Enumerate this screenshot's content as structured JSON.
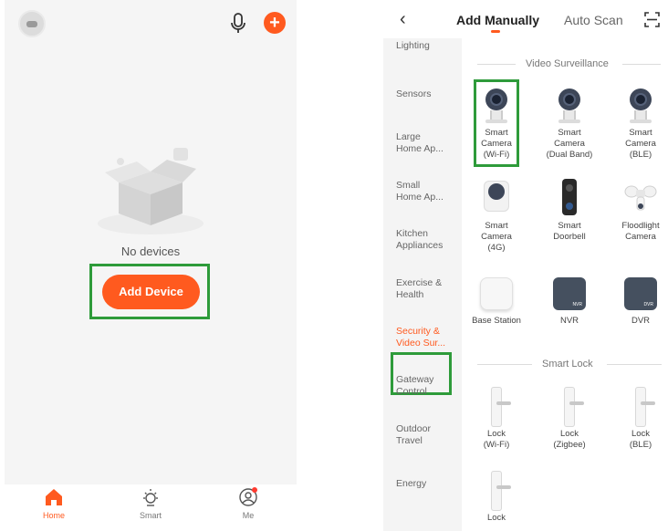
{
  "left_screen": {
    "empty_state_text": "No devices",
    "add_device_label": "Add Device",
    "tabs": [
      {
        "label": "Home",
        "active": true
      },
      {
        "label": "Smart",
        "active": false
      },
      {
        "label": "Me",
        "active": false
      }
    ]
  },
  "right_screen": {
    "tab_manual": "Add Manually",
    "tab_auto": "Auto Scan",
    "categories": [
      {
        "label": "Lighting"
      },
      {
        "label": "Sensors"
      },
      {
        "label": "Large Home Ap..."
      },
      {
        "label": "Small Home Ap..."
      },
      {
        "label": "Kitchen Appliances"
      },
      {
        "label": "Exercise & Health"
      },
      {
        "label": "Security & Video Sur...",
        "active": true
      },
      {
        "label": "Gateway Control"
      },
      {
        "label": "Outdoor Travel"
      },
      {
        "label": "Energy"
      }
    ],
    "sections": [
      {
        "title": "Video Surveillance",
        "devices": [
          {
            "label": "Smart Camera (Wi-Fi)"
          },
          {
            "label": "Smart Camera (Dual Band)"
          },
          {
            "label": "Smart Camera (BLE)"
          },
          {
            "label": "Smart Camera (4G)"
          },
          {
            "label": "Smart Doorbell"
          },
          {
            "label": "Floodlight Camera"
          },
          {
            "label": "Base Station"
          },
          {
            "label": "NVR",
            "badge": "NVR"
          },
          {
            "label": "DVR",
            "badge": "DVR"
          }
        ]
      },
      {
        "title": "Smart Lock",
        "devices": [
          {
            "label": "Lock (Wi-Fi)"
          },
          {
            "label": "Lock (Zigbee)"
          },
          {
            "label": "Lock (BLE)"
          },
          {
            "label": "Lock"
          }
        ]
      }
    ]
  },
  "colors": {
    "accent": "#ff5a1f",
    "highlight_frame": "#2e9b3a"
  }
}
